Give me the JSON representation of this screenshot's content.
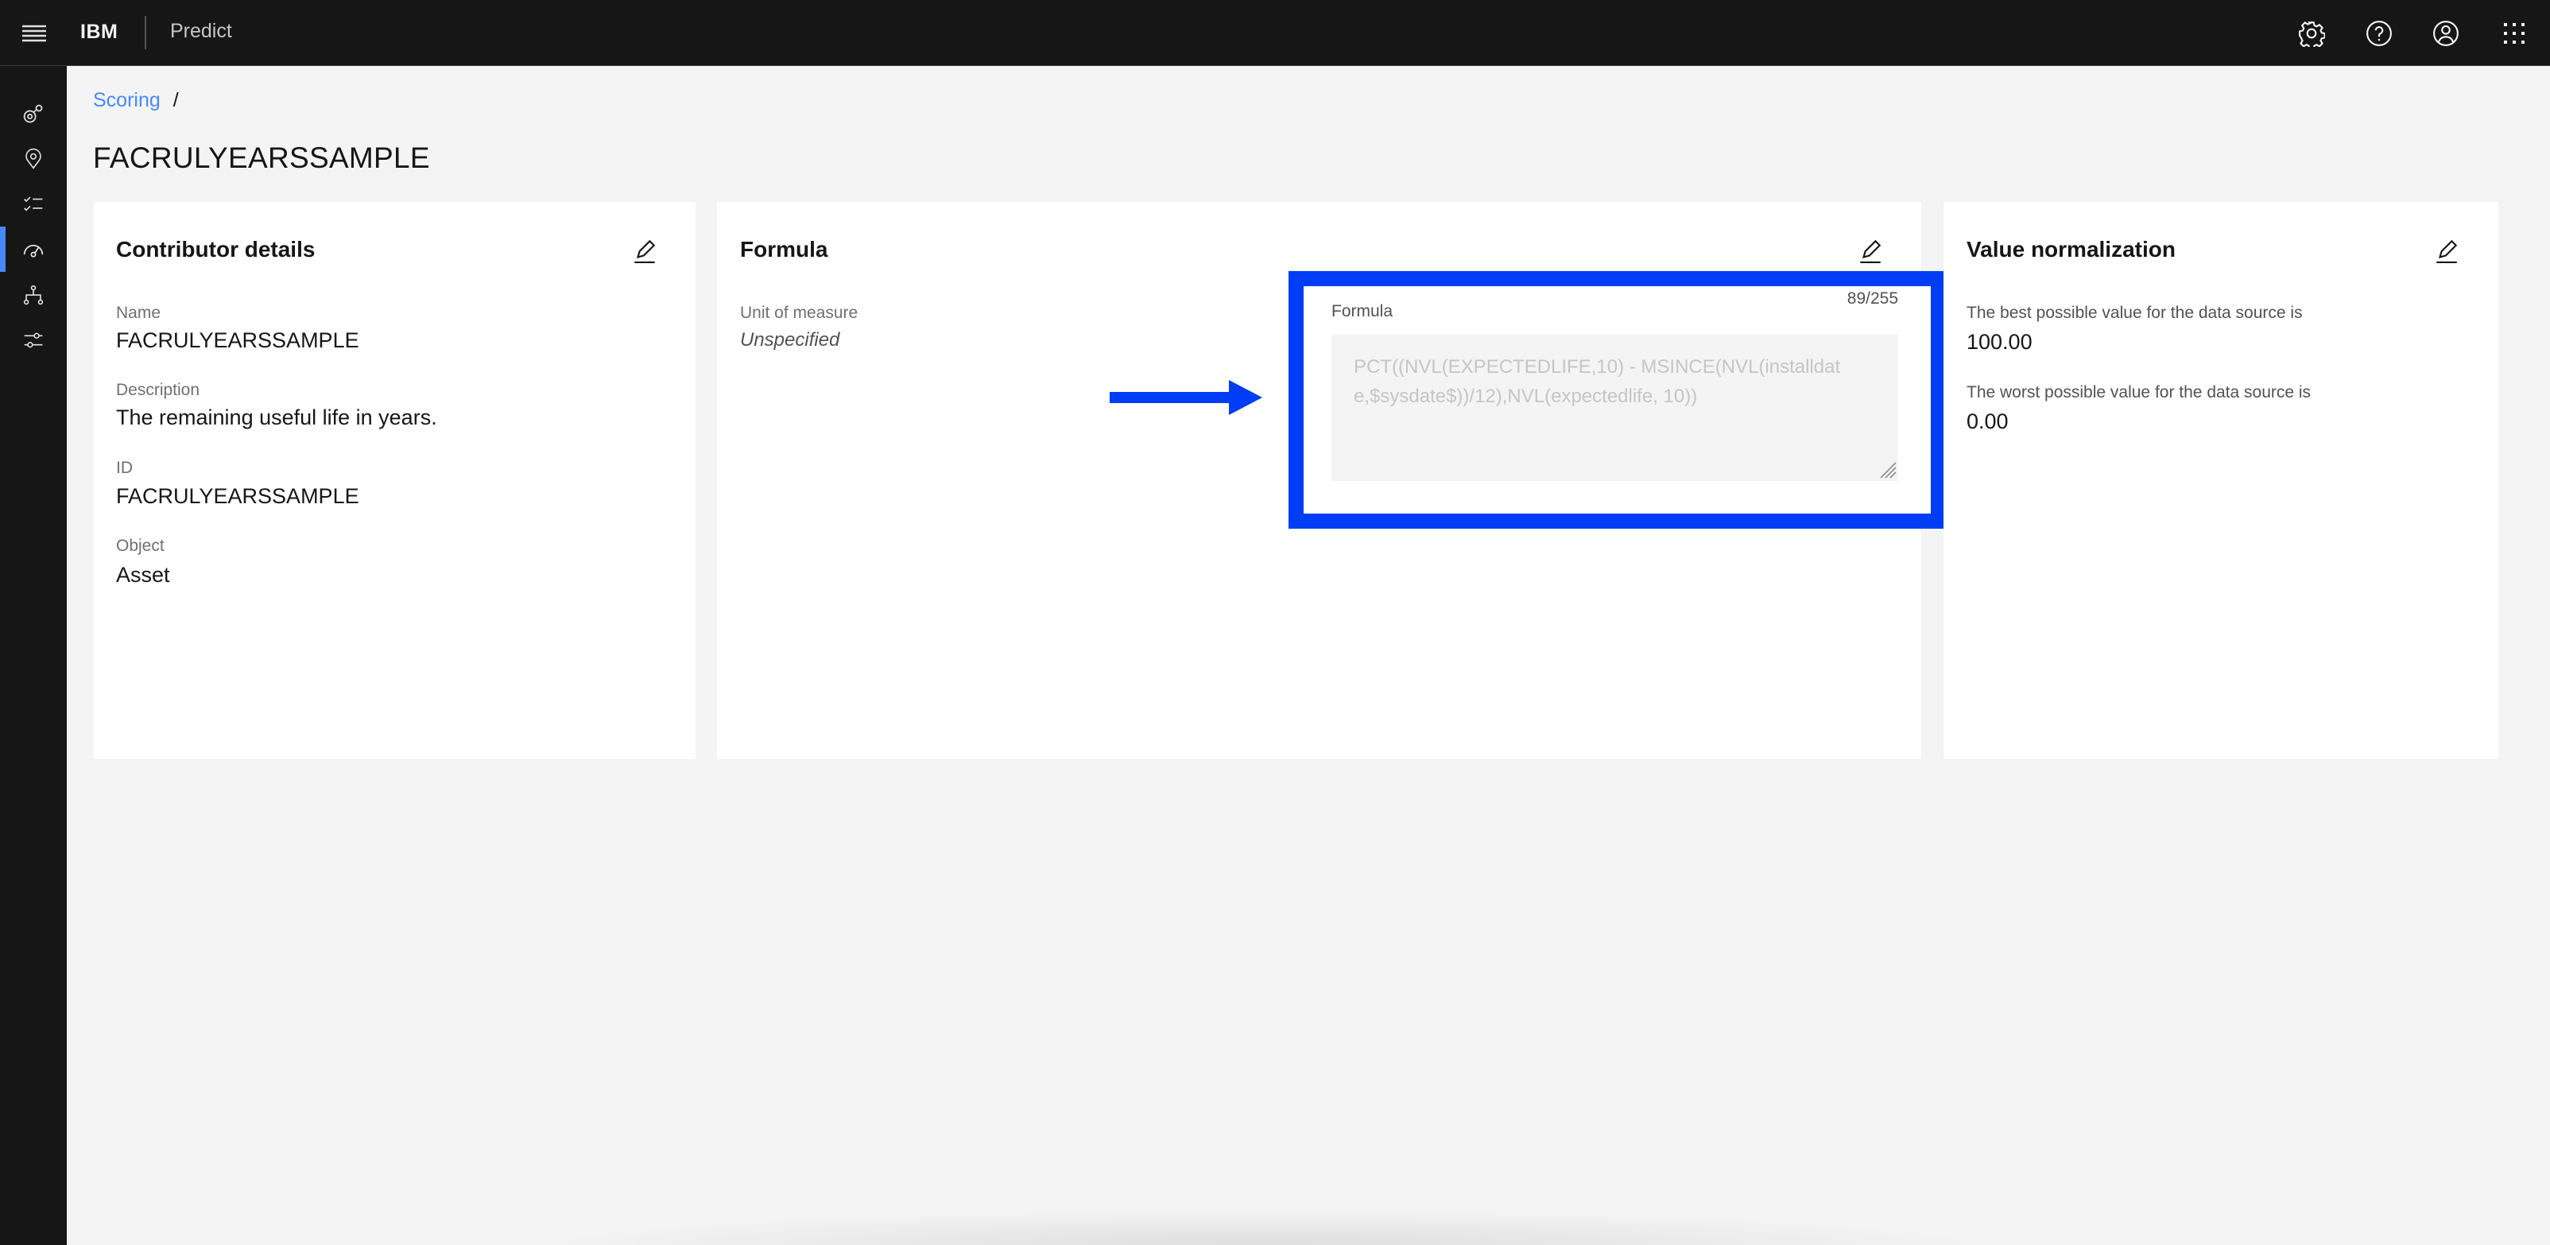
{
  "header": {
    "brand": "IBM",
    "product": "Predict",
    "menu_icon": "hamburger-menu-icon",
    "actions": [
      {
        "name": "settings",
        "icon": "gear-icon"
      },
      {
        "name": "help",
        "icon": "help-icon"
      },
      {
        "name": "user",
        "icon": "user-avatar-icon"
      },
      {
        "name": "app-switcher",
        "icon": "app-switcher-icon"
      }
    ]
  },
  "sidebar": {
    "items": [
      {
        "name": "models",
        "icon": "model-icon",
        "active": false
      },
      {
        "name": "locations",
        "icon": "location-icon",
        "active": false
      },
      {
        "name": "checklists",
        "icon": "checklist-icon",
        "active": false
      },
      {
        "name": "scoring",
        "icon": "gauge-icon",
        "active": true
      },
      {
        "name": "hierarchy",
        "icon": "hierarchy-icon",
        "active": false
      },
      {
        "name": "settings",
        "icon": "sliders-icon",
        "active": false
      }
    ]
  },
  "breadcrumb": {
    "items": [
      {
        "label": "Scoring"
      }
    ],
    "separator": "/"
  },
  "page": {
    "title": "FACRULYEARSSAMPLE"
  },
  "contributor": {
    "title": "Contributor details",
    "fields": [
      {
        "label": "Name",
        "value": "FACRULYEARSSAMPLE"
      },
      {
        "label": "Description",
        "value": "The remaining useful life in years."
      },
      {
        "label": "ID",
        "value": "FACRULYEARSSAMPLE"
      },
      {
        "label": "Object",
        "value": "Asset"
      }
    ]
  },
  "formula": {
    "title": "Formula",
    "unit_label": "Unit of measure",
    "unit_value": "Unspecified",
    "field_label": "Formula",
    "counter": "89/255",
    "value": "PCT((NVL(EXPECTEDLIFE,10) - MSINCE(NVL(installdate,$sysdate$))/12),NVL(expectedlife, 10))",
    "highlight_color": "#003df5"
  },
  "normalization": {
    "title": "Value normalization",
    "best_label": "The best possible value for the data source is",
    "best_value": "100.00",
    "worst_label": "The worst possible value for the data source is",
    "worst_value": "0.00"
  },
  "colors": {
    "header_bg": "#161616",
    "accent": "#4589ff",
    "page_bg": "#f4f4f4",
    "annotation_blue": "#003df5"
  }
}
